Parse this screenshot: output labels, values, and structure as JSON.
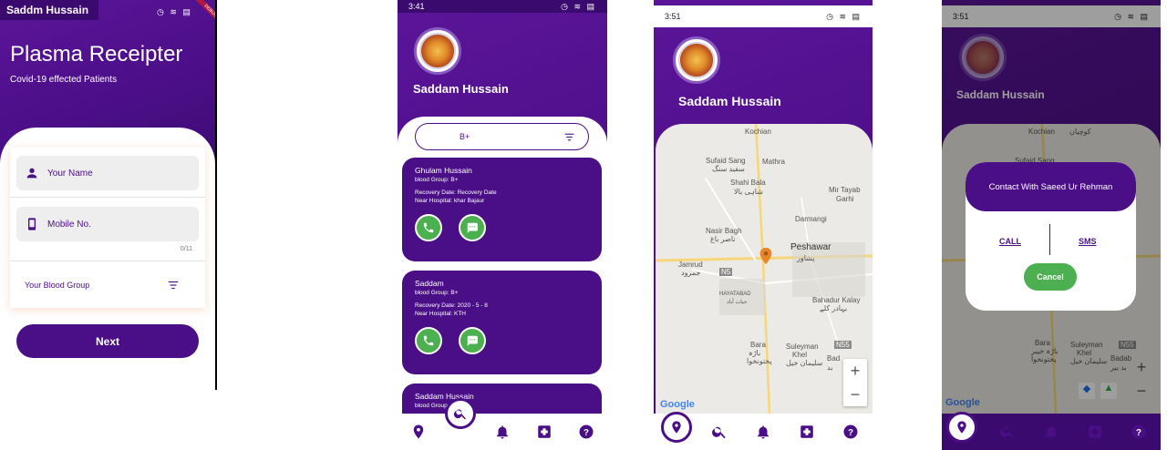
{
  "screen1": {
    "appbar_title": "Saddm Hussain",
    "debug_badge": "DEBUG",
    "heading": "Plasma Receipter",
    "subheading": "Covid-19 effected Patients",
    "name_placeholder": "Your Name",
    "mobile_placeholder": "Mobile No.",
    "mobile_counter": "0/11",
    "blood_group_label": "Your Blood Group",
    "next_label": "Next"
  },
  "screen2": {
    "time": "3:41",
    "user_name": "Saddam Hussain",
    "filter_value": "B+",
    "cards": [
      {
        "name": "Ghulam Hussain",
        "blood": "blood Group: B+",
        "recovery": "Recovery Date: Recovery Date",
        "hospital": "Near Hospital: khar Bajaur"
      },
      {
        "name": "Saddam",
        "blood": "blood Group: B+",
        "recovery": "Recovery Date: 2020 - 5 - 8",
        "hospital": "Near Hospital: KTH"
      },
      {
        "name": "Saddam Hussain",
        "blood": "blood Group: B+"
      }
    ]
  },
  "screen3": {
    "time": "3:51",
    "user_name": "Saddam Hussain",
    "map_labels": {
      "kochian": "Kochian",
      "sufaid_sang": "Sufaid Sang",
      "sufaid_sang_ur": "سفید سنگ",
      "mathra": "Mathra",
      "shahi_bala": "Shahi Bala",
      "shahi_bala_ur": "شاہی بالا",
      "mir_tayab": "Mir Tayab",
      "mir_tayab2": "Garhi",
      "darmangi": "Darmangi",
      "nasir_bagh": "Nasir Bagh",
      "nasir_bagh_ur": "ناصر باغ",
      "peshawar": "Peshawar",
      "peshawar_ur": "پشاور",
      "jamrud": "Jamrud",
      "jamrud_ur": "جمرود",
      "n5": "N5",
      "hayatabad": "HAYATABAD",
      "hayatabad_ur": "حیات آباد",
      "bahadur": "Bahadur Kalay",
      "bahadur_ur": "بہادر کلے",
      "bara": "Bara",
      "bara_ur": "باڑہ",
      "bara_ur2": "پختونخوا",
      "suleyman": "Suleyman",
      "suleyman2": "Khel",
      "suleyman_ur": "سلیمان خیل",
      "badab": "Bad",
      "badab_ur": "بد",
      "n55": "N55"
    },
    "zoom_in": "+",
    "zoom_out": "−",
    "google": "Google"
  },
  "screen4": {
    "time": "3:51",
    "user_name": "Saddam Hussain",
    "dialog_title": "Contact With Saeed Ur Rehman",
    "call_label": "CALL",
    "sms_label": "SMS",
    "cancel_label": "Cancel",
    "map_labels": {
      "kochian": "Kochian",
      "kochian_ur": "کوچیان",
      "sufaid": "Sufaid Sang",
      "bara": "Bara",
      "bara_ur": "باڑہ خیبر",
      "bara_ur2": "پختونخوا",
      "suleyman": "Suleyman",
      "suleyman2": "Khel",
      "suleyman_ur": "سلیمان خیل",
      "badab": "Badab",
      "badab_ur": "بد بیر",
      "n55": "N55"
    },
    "zoom_in": "+",
    "zoom_out": "−",
    "google": "Google"
  },
  "colors": {
    "primary": "#4a0e86",
    "accent": "#4caf50",
    "white": "#ffffff"
  }
}
